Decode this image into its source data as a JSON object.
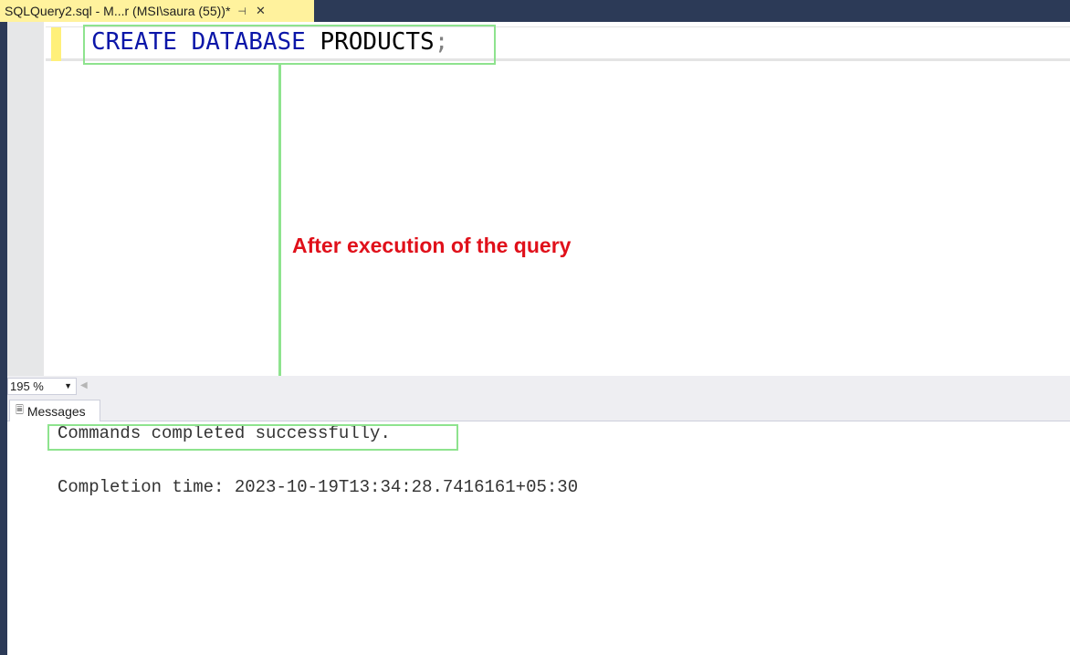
{
  "tab": {
    "title": "SQLQuery2.sql - M...r (MSI\\saura (55))*",
    "pin_icon": "pin-icon",
    "close_icon": "close-icon"
  },
  "editor": {
    "code": {
      "keyword1": "CREATE",
      "keyword2": "DATABASE",
      "identifier": "PRODUCTS",
      "terminator": ";"
    }
  },
  "annotation": {
    "text": "After execution of the query",
    "color": "#e0101a"
  },
  "status": {
    "zoom": "195 %"
  },
  "results": {
    "tab_label": "Messages",
    "line1": "Commands completed successfully.",
    "line2": "Completion time: 2023-10-19T13:34:28.7416161+05:30"
  },
  "colors": {
    "highlight_box": "#8ee38e",
    "keyword": "#0b16a8",
    "tab_active": "#fff29d",
    "chrome": "#2c3a57"
  }
}
